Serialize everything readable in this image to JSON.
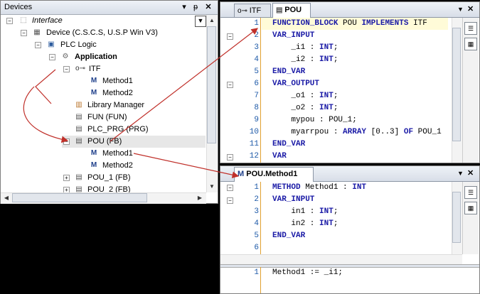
{
  "devices": {
    "title": "Devices",
    "pin_glyph": "ᵽ",
    "close_glyph": "✕",
    "dropdown_glyph": "▼",
    "tree": [
      {
        "label": "Interface",
        "italic": true
      },
      {
        "label": "Device (C.S.C.S, U.S.P Win V3)"
      },
      {
        "label": "PLC Logic"
      },
      {
        "label": "Application",
        "bold": true
      },
      {
        "label": "ITF"
      },
      {
        "label": "Method1"
      },
      {
        "label": "Method2"
      },
      {
        "label": "Library Manager"
      },
      {
        "label": "FUN (FUN)"
      },
      {
        "label": "PLC_PRG (PRG)"
      },
      {
        "label": "POU (FB)"
      },
      {
        "label": "Method1"
      },
      {
        "label": "Method2"
      },
      {
        "label": "POU_1 (FB)"
      },
      {
        "label": "POU_2 (FB)"
      }
    ]
  },
  "pou_editor": {
    "tabs": [
      {
        "label": "ITF",
        "active": false
      },
      {
        "label": "POU",
        "active": true
      }
    ],
    "line_numbers": [
      "1",
      "2",
      "3",
      "4",
      "5",
      "6",
      "7",
      "8",
      "9",
      "10",
      "11",
      "12"
    ],
    "lines": [
      "FUNCTION_BLOCK POU IMPLEMENTS ITF",
      "VAR_INPUT",
      "    _i1 : INT;",
      "    _i2 : INT;",
      "END_VAR",
      "VAR_OUTPUT",
      "    _o1 : INT;",
      "    _o2 : INT;",
      "    mypou : POU_1;",
      "    myarrpou : ARRAY [0..3] OF POU_1",
      "END_VAR",
      "VAR"
    ]
  },
  "method_editor": {
    "tab": "POU.Method1",
    "line_numbers": [
      "1",
      "2",
      "3",
      "4",
      "5",
      "6"
    ],
    "lines": [
      "METHOD Method1 : INT",
      "VAR_INPUT",
      "    in1 : INT;",
      "    in2 : INT;",
      "END_VAR",
      ""
    ],
    "impl_line_numbers": [
      "1"
    ],
    "impl_lines": [
      "Method1 := _i1;"
    ]
  },
  "colors": {
    "keyword": "#1a1aa6",
    "line_number": "#1e5aa8",
    "arrow": "#c0302a"
  }
}
